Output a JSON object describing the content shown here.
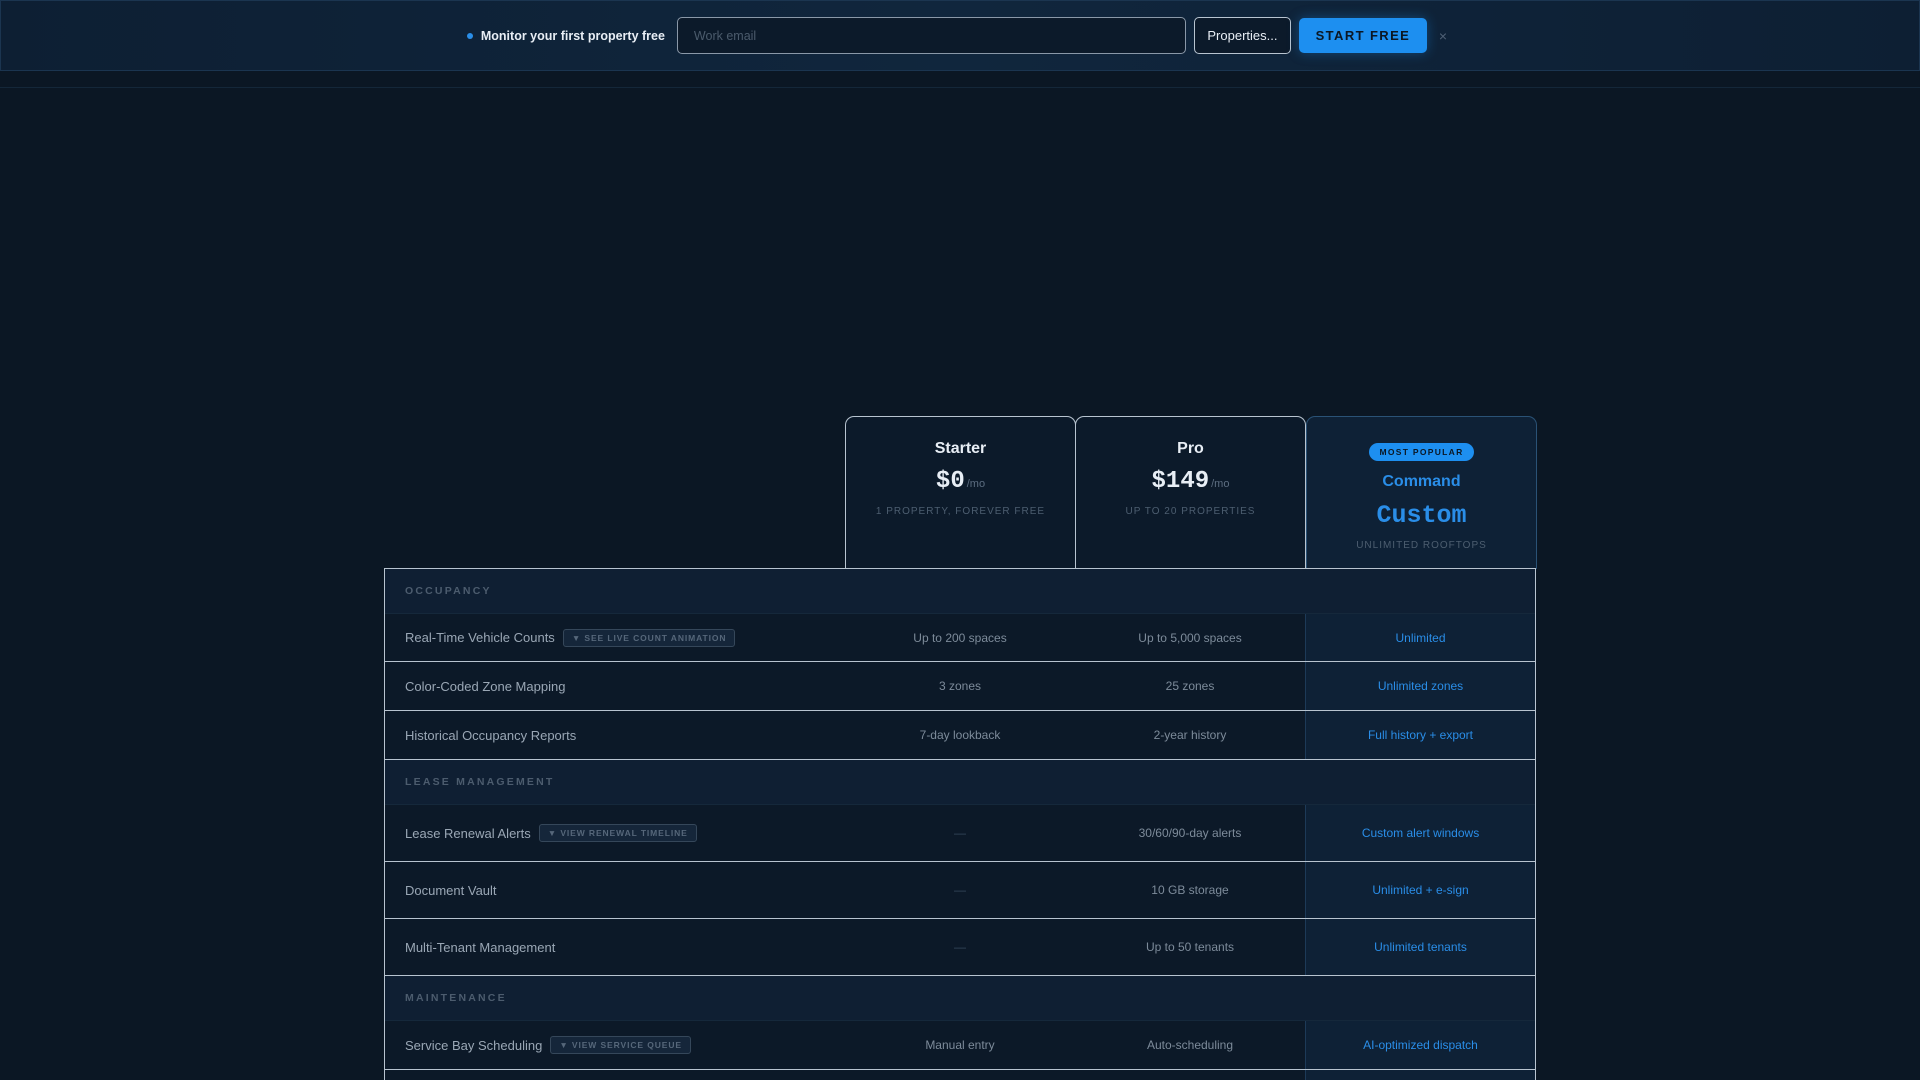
{
  "banner": {
    "text": "Monitor your first property free",
    "email_placeholder": "Work email",
    "properties_label": "Properties...",
    "start_label": "START FREE",
    "close_symbol": "×"
  },
  "plans": [
    {
      "name": "Starter",
      "price": "$0",
      "period": "/mo",
      "subtitle": "1 PROPERTY, FOREVER FREE"
    },
    {
      "name": "Pro",
      "price": "$149",
      "period": "/mo",
      "subtitle": "UP TO 20 PROPERTIES"
    },
    {
      "badge": "MOST POPULAR",
      "name": "Command",
      "price": "Custom",
      "subtitle": "UNLIMITED ROOFTOPS"
    }
  ],
  "sections": [
    {
      "title": "OCCUPANCY",
      "rows": [
        {
          "name": "Real-Time Vehicle Counts",
          "chip": "▼ SEE LIVE COUNT ANIMATION",
          "starter": "Up to 200 spaces",
          "pro": "Up to 5,000 spaces",
          "command": "Unlimited"
        },
        {
          "name": "Color-Coded Zone Mapping",
          "starter": "3 zones",
          "pro": "25 zones",
          "command": "Unlimited zones"
        },
        {
          "name": "Historical Occupancy Reports",
          "starter": "7-day lookback",
          "pro": "2-year history",
          "command": "Full history + export"
        }
      ]
    },
    {
      "title": "LEASE MANAGEMENT",
      "rows": [
        {
          "name": "Lease Renewal Alerts",
          "chip": "▼ VIEW RENEWAL TIMELINE",
          "starter": "—",
          "pro": "30/60/90-day alerts",
          "command": "Custom alert windows"
        },
        {
          "name": "Document Vault",
          "starter": "—",
          "pro": "10 GB storage",
          "command": "Unlimited + e-sign"
        },
        {
          "name": "Multi-Tenant Management",
          "starter": "—",
          "pro": "Up to 50 tenants",
          "command": "Unlimited tenants"
        }
      ]
    },
    {
      "title": "MAINTENANCE",
      "rows": [
        {
          "name": "Service Bay Scheduling",
          "chip": "▼ VIEW SERVICE QUEUE",
          "starter": "Manual entry",
          "pro": "Auto-scheduling",
          "command": "AI-optimized dispatch"
        }
      ]
    }
  ],
  "colors": {
    "accent": "#1d8ff0",
    "background": "#0b1724",
    "panel": "#0c1928"
  }
}
